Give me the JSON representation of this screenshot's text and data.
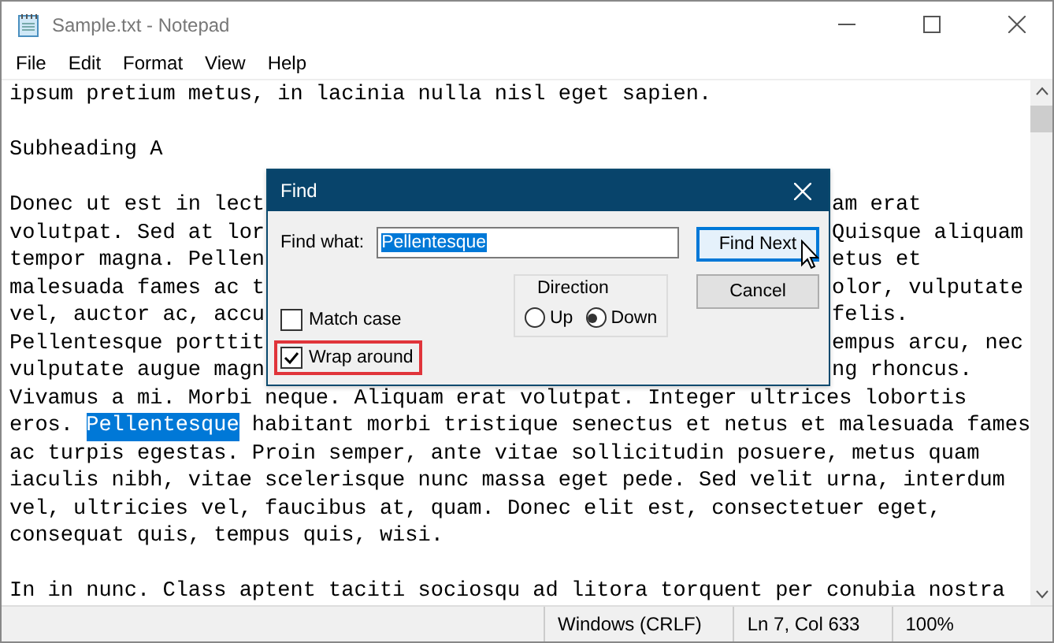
{
  "window": {
    "title": "Sample.txt - Notepad"
  },
  "menu": [
    "File",
    "Edit",
    "Format",
    "View",
    "Help"
  ],
  "lines": [
    {
      "kind": "text",
      "text": "ipsum pretium metus, in lacinia nulla nisl eget sapien."
    },
    {
      "kind": "blank"
    },
    {
      "kind": "text",
      "text": "Subheading A"
    },
    {
      "kind": "blank"
    },
    {
      "kind": "split",
      "left": "Donec ut est in lect",
      "right": "am erat"
    },
    {
      "kind": "split",
      "left": "volutpat. Sed at lor",
      "right": "Quisque aliquam"
    },
    {
      "kind": "split",
      "left": "tempor magna. Pellen",
      "right": "etus et"
    },
    {
      "kind": "split",
      "left": "malesuada fames ac t",
      "right": "olor, vulputate"
    },
    {
      "kind": "split",
      "left": "vel, auctor ac, accu",
      "right": "felis."
    },
    {
      "kind": "split",
      "left": "Pellentesque porttit",
      "right": "empus arcu, nec"
    },
    {
      "kind": "split",
      "left": "vulputate augue magn",
      "right": "ng rhoncus."
    },
    {
      "kind": "text",
      "text": "Vivamus a mi. Morbi neque. Aliquam erat volutpat. Integer ultrices lobortis"
    },
    {
      "kind": "parts",
      "parts": [
        {
          "text": "eros. ",
          "selected": false
        },
        {
          "text": "Pellentesque",
          "selected": true
        },
        {
          "text": " habitant morbi tristique senectus et netus et malesuada fames",
          "selected": false
        }
      ]
    },
    {
      "kind": "text",
      "text": "ac turpis egestas. Proin semper, ante vitae sollicitudin posuere, metus quam"
    },
    {
      "kind": "text",
      "text": "iaculis nibh, vitae scelerisque nunc massa eget pede. Sed velit urna, interdum"
    },
    {
      "kind": "text",
      "text": "vel, ultricies vel, faucibus at, quam. Donec elit est, consectetuer eget,"
    },
    {
      "kind": "text",
      "text": "consequat quis, tempus quis, wisi."
    },
    {
      "kind": "blank"
    },
    {
      "kind": "text",
      "text": "In in nunc. Class aptent taciti sociosqu ad litora torquent per conubia nostra"
    }
  ],
  "find_dialog": {
    "title": "Find",
    "label": "Find what:",
    "value": "Pellentesque",
    "find_next": "Find Next",
    "cancel": "Cancel",
    "direction": {
      "label": "Direction",
      "options": [
        {
          "label": "Up",
          "selected": false
        },
        {
          "label": "Down",
          "selected": true
        }
      ]
    },
    "options": [
      {
        "label": "Match case",
        "checked": false,
        "highlighted": false
      },
      {
        "label": "Wrap around",
        "checked": true,
        "highlighted": true
      }
    ]
  },
  "status_bar": [
    "Windows (CRLF)",
    "Ln 7, Col 633",
    "100%"
  ]
}
